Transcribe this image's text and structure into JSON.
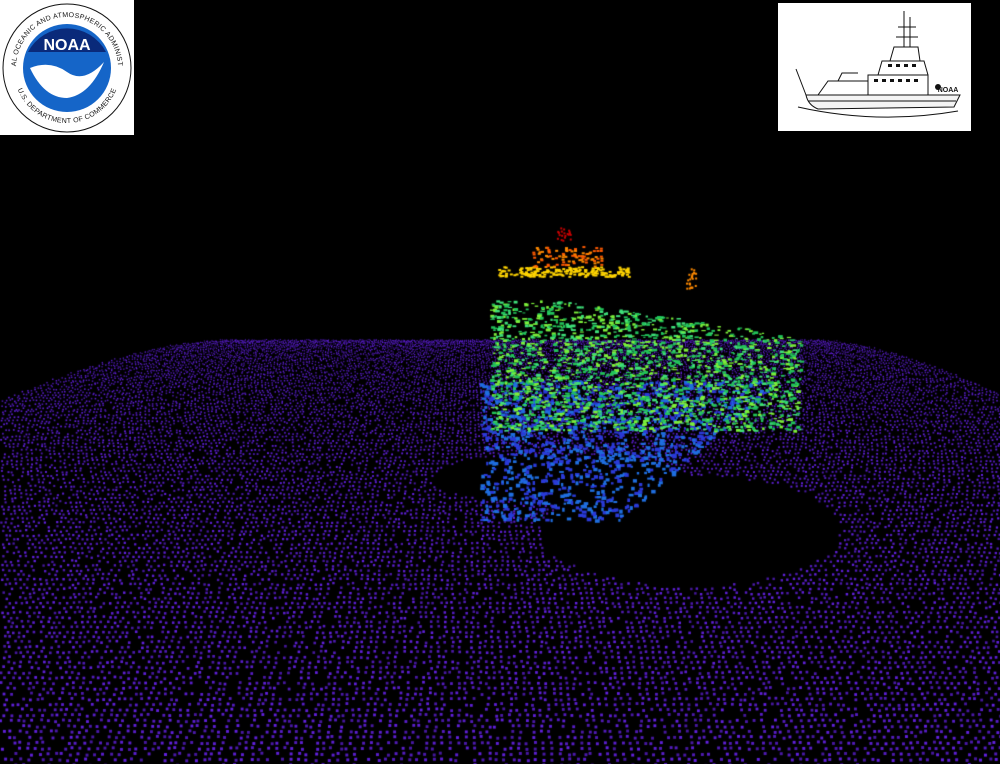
{
  "logo": {
    "center_text": "NOAA",
    "ring_text_top": "NATIONAL OCEANIC AND ATMOSPHERIC ADMINISTRATION",
    "ring_text_bottom": "U.S. DEPARTMENT OF COMMERCE",
    "colors": {
      "ring": "#ffffff",
      "disc": "#1565c8",
      "inner": "#0a2a7a",
      "bird": "#ffffff"
    }
  },
  "ship": {
    "hull_text": "NOAA",
    "illustration": "survey-ship-line-drawing"
  },
  "scene": {
    "description_colors": {
      "background": "#000000",
      "seafloor": "#5a1fd0",
      "deep": "#2a2ad8",
      "mid": "#22c35a",
      "upper": "#7cf03a",
      "top": "#ffd400",
      "peak": "#ff5a00",
      "apex": "#c80000"
    }
  }
}
